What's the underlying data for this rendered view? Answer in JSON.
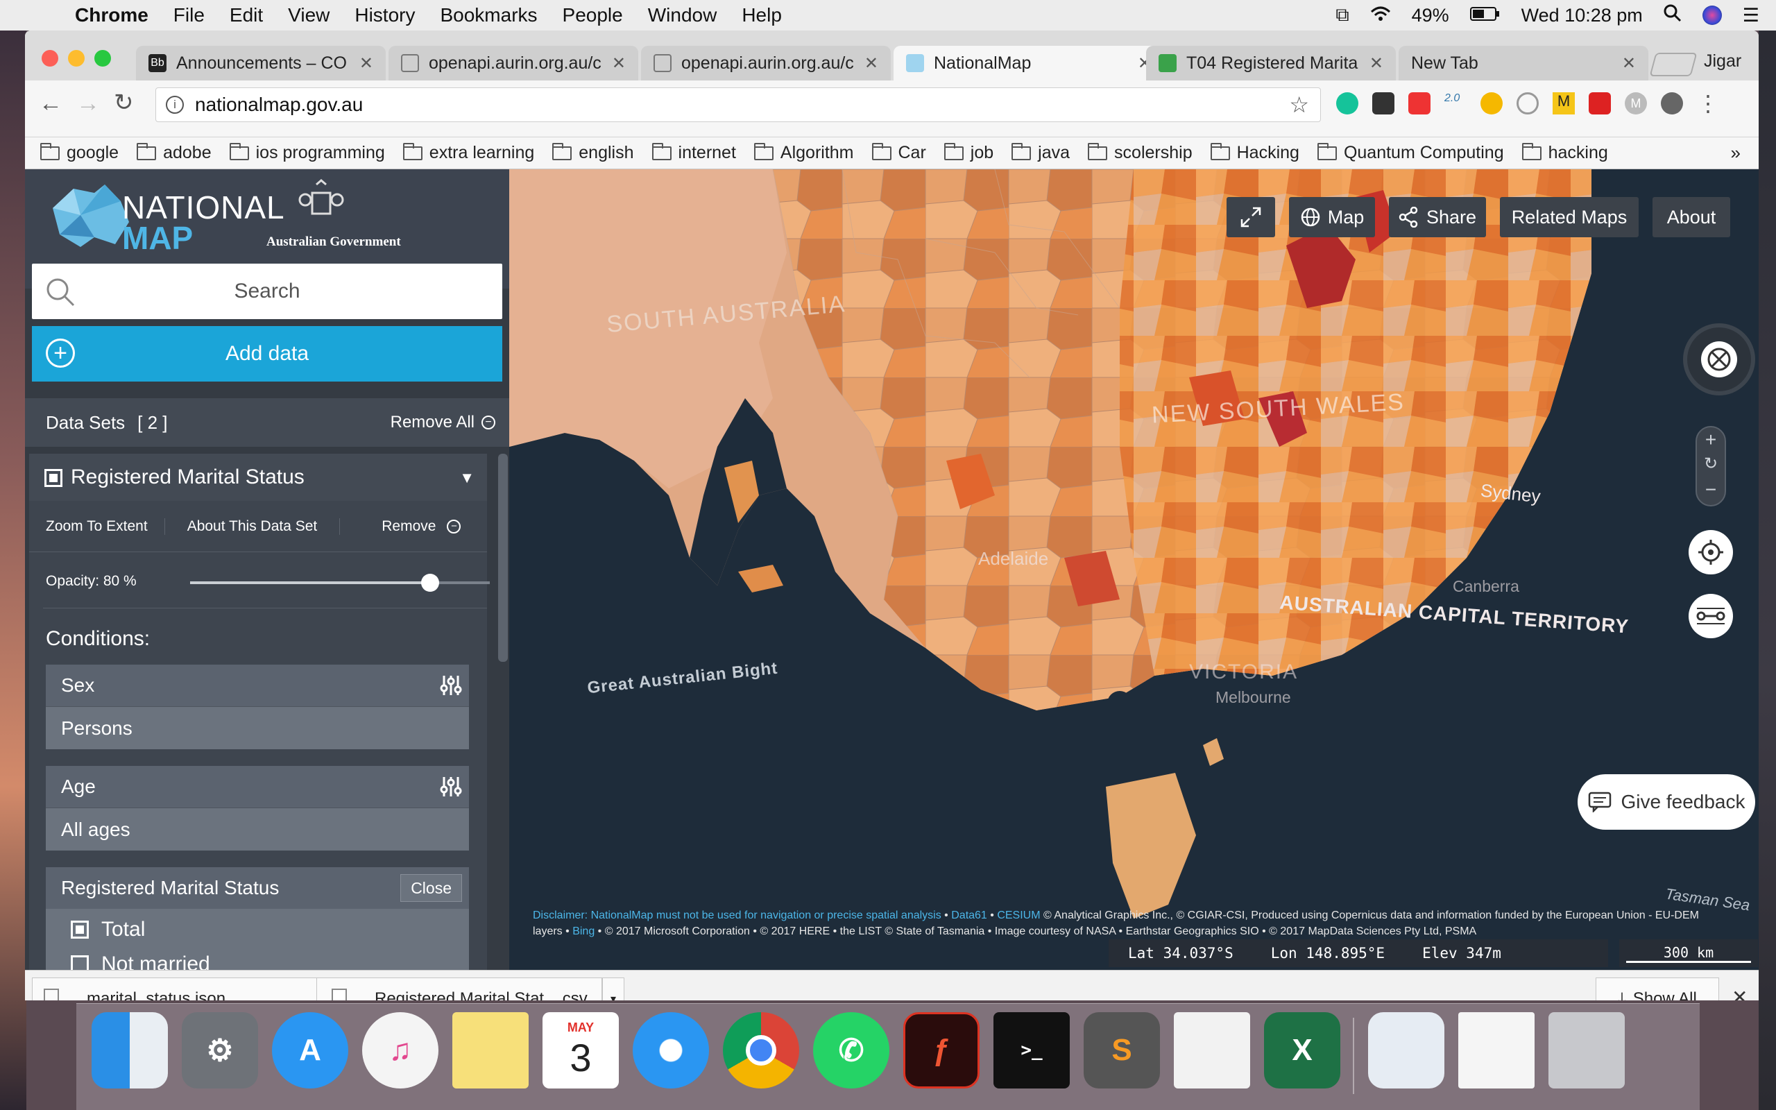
{
  "menubar": {
    "app": "Chrome",
    "items": [
      "File",
      "Edit",
      "View",
      "History",
      "Bookmarks",
      "People",
      "Window",
      "Help"
    ],
    "battery": "49%",
    "clock": "Wed 10:28 pm"
  },
  "browser": {
    "tabs": [
      {
        "title": "Announcements – CO"
      },
      {
        "title": "openapi.aurin.org.au/c"
      },
      {
        "title": "openapi.aurin.org.au/c"
      },
      {
        "title": "NationalMap"
      },
      {
        "title": "T04 Registered Marita"
      },
      {
        "title": "New Tab"
      }
    ],
    "profile": "Jigar",
    "url": "nationalmap.gov.au",
    "bookmarks": [
      "google",
      "adobe",
      "ios programming",
      "extra learning",
      "english",
      "internet",
      "Algorithm",
      "Car",
      "job",
      "java",
      "scolership",
      "Hacking",
      "Quantum Computing",
      "hacking"
    ]
  },
  "nationalmap": {
    "logo": {
      "line1": "NATIONAL",
      "line2": "MAP",
      "gov": "Australian Government"
    },
    "search_placeholder": "Search",
    "add_data": "Add data",
    "datasets": {
      "label": "Data Sets",
      "count": "[ 2 ]",
      "remove_all": "Remove All"
    },
    "dataset": {
      "title": "Registered Marital Status",
      "zoom": "Zoom To Extent",
      "about": "About This Data Set",
      "remove": "Remove",
      "opacity_label": "Opacity: 80 %",
      "opacity": 0.8,
      "conditions": "Conditions:",
      "sex_label": "Sex",
      "sex_value": "Persons",
      "age_label": "Age",
      "age_value": "All ages",
      "rms_label": "Registered Marital Status",
      "close": "Close",
      "total": "Total",
      "next_option": "Not married"
    },
    "map_buttons": {
      "map": "Map",
      "share": "Share",
      "related": "Related Maps",
      "about": "About"
    },
    "labels": {
      "sa": "SOUTH AUSTRALIA",
      "nsw": "NEW SOUTH WALES",
      "sydney": "Sydney",
      "adelaide": "Adelaide",
      "act": "AUSTRALIAN CAPITAL TERRITORY",
      "bight": "Great Australian Bight",
      "tasman": "Tasman Sea",
      "vic": "VICTORIA",
      "melbourne": "Melbourne",
      "canberra": "Canberra"
    },
    "feedback": "Give feedback",
    "disclaimer_prefix": "Disclaimer: NationalMap must not be used for navigation or precise spatial analysis",
    "data61": "Data61",
    "cesium": "CESIUM",
    "credits1": "© Analytical Graphics Inc., © CGIAR-CSI, Produced using Copernicus data and information funded by the European Union - EU-DEM",
    "credits2_prefix": "layers •",
    "bing": "Bing",
    "credits2": "• © 2017 Microsoft Corporation • © 2017 HERE • the LIST © State of Tasmania • Image courtesy of NASA • Earthstar Geographics SIO • © 2017 MapData Sciences Pty Ltd, PSMA",
    "lat": "Lat  34.037°S",
    "lon": "Lon  148.895°E",
    "elev": "Elev  347m",
    "scale": "300 km"
  },
  "downloads": {
    "file1": "marital_status.json",
    "file2": "Registered Marital Stat....csv",
    "show_all": "Show All"
  },
  "dock": {
    "calendar_month": "MAY",
    "calendar_day": "3"
  },
  "colors": {
    "accent": "#1ba5d8",
    "sidebar": "#353b43",
    "map_sea": "#1e2c3a"
  }
}
